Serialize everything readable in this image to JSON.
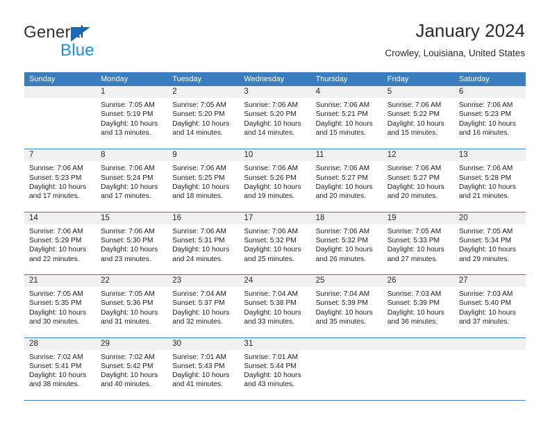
{
  "brand": {
    "name_part1": "General",
    "name_part2": "Blue",
    "triangle_color": "#1a6bb5",
    "blue_color": "#1a8fe0"
  },
  "header": {
    "title": "January 2024",
    "subtitle": "Crowley, Louisiana, United States",
    "header_bg_color": "#3a7ebf",
    "day_band_color": "#f0f0f0"
  },
  "weekdays": [
    "Sunday",
    "Monday",
    "Tuesday",
    "Wednesday",
    "Thursday",
    "Friday",
    "Saturday"
  ],
  "weeks": [
    [
      {
        "date": "",
        "sunrise": "",
        "sunset": "",
        "daylight_line1": "",
        "daylight_line2": ""
      },
      {
        "date": "1",
        "sunrise": "Sunrise: 7:05 AM",
        "sunset": "Sunset: 5:19 PM",
        "daylight_line1": "Daylight: 10 hours",
        "daylight_line2": "and 13 minutes."
      },
      {
        "date": "2",
        "sunrise": "Sunrise: 7:05 AM",
        "sunset": "Sunset: 5:20 PM",
        "daylight_line1": "Daylight: 10 hours",
        "daylight_line2": "and 14 minutes."
      },
      {
        "date": "3",
        "sunrise": "Sunrise: 7:06 AM",
        "sunset": "Sunset: 5:20 PM",
        "daylight_line1": "Daylight: 10 hours",
        "daylight_line2": "and 14 minutes."
      },
      {
        "date": "4",
        "sunrise": "Sunrise: 7:06 AM",
        "sunset": "Sunset: 5:21 PM",
        "daylight_line1": "Daylight: 10 hours",
        "daylight_line2": "and 15 minutes."
      },
      {
        "date": "5",
        "sunrise": "Sunrise: 7:06 AM",
        "sunset": "Sunset: 5:22 PM",
        "daylight_line1": "Daylight: 10 hours",
        "daylight_line2": "and 15 minutes."
      },
      {
        "date": "6",
        "sunrise": "Sunrise: 7:06 AM",
        "sunset": "Sunset: 5:23 PM",
        "daylight_line1": "Daylight: 10 hours",
        "daylight_line2": "and 16 minutes."
      }
    ],
    [
      {
        "date": "7",
        "sunrise": "Sunrise: 7:06 AM",
        "sunset": "Sunset: 5:23 PM",
        "daylight_line1": "Daylight: 10 hours",
        "daylight_line2": "and 17 minutes."
      },
      {
        "date": "8",
        "sunrise": "Sunrise: 7:06 AM",
        "sunset": "Sunset: 5:24 PM",
        "daylight_line1": "Daylight: 10 hours",
        "daylight_line2": "and 17 minutes."
      },
      {
        "date": "9",
        "sunrise": "Sunrise: 7:06 AM",
        "sunset": "Sunset: 5:25 PM",
        "daylight_line1": "Daylight: 10 hours",
        "daylight_line2": "and 18 minutes."
      },
      {
        "date": "10",
        "sunrise": "Sunrise: 7:06 AM",
        "sunset": "Sunset: 5:26 PM",
        "daylight_line1": "Daylight: 10 hours",
        "daylight_line2": "and 19 minutes."
      },
      {
        "date": "11",
        "sunrise": "Sunrise: 7:06 AM",
        "sunset": "Sunset: 5:27 PM",
        "daylight_line1": "Daylight: 10 hours",
        "daylight_line2": "and 20 minutes."
      },
      {
        "date": "12",
        "sunrise": "Sunrise: 7:06 AM",
        "sunset": "Sunset: 5:27 PM",
        "daylight_line1": "Daylight: 10 hours",
        "daylight_line2": "and 20 minutes."
      },
      {
        "date": "13",
        "sunrise": "Sunrise: 7:06 AM",
        "sunset": "Sunset: 5:28 PM",
        "daylight_line1": "Daylight: 10 hours",
        "daylight_line2": "and 21 minutes."
      }
    ],
    [
      {
        "date": "14",
        "sunrise": "Sunrise: 7:06 AM",
        "sunset": "Sunset: 5:29 PM",
        "daylight_line1": "Daylight: 10 hours",
        "daylight_line2": "and 22 minutes."
      },
      {
        "date": "15",
        "sunrise": "Sunrise: 7:06 AM",
        "sunset": "Sunset: 5:30 PM",
        "daylight_line1": "Daylight: 10 hours",
        "daylight_line2": "and 23 minutes."
      },
      {
        "date": "16",
        "sunrise": "Sunrise: 7:06 AM",
        "sunset": "Sunset: 5:31 PM",
        "daylight_line1": "Daylight: 10 hours",
        "daylight_line2": "and 24 minutes."
      },
      {
        "date": "17",
        "sunrise": "Sunrise: 7:06 AM",
        "sunset": "Sunset: 5:32 PM",
        "daylight_line1": "Daylight: 10 hours",
        "daylight_line2": "and 25 minutes."
      },
      {
        "date": "18",
        "sunrise": "Sunrise: 7:06 AM",
        "sunset": "Sunset: 5:32 PM",
        "daylight_line1": "Daylight: 10 hours",
        "daylight_line2": "and 26 minutes."
      },
      {
        "date": "19",
        "sunrise": "Sunrise: 7:05 AM",
        "sunset": "Sunset: 5:33 PM",
        "daylight_line1": "Daylight: 10 hours",
        "daylight_line2": "and 27 minutes."
      },
      {
        "date": "20",
        "sunrise": "Sunrise: 7:05 AM",
        "sunset": "Sunset: 5:34 PM",
        "daylight_line1": "Daylight: 10 hours",
        "daylight_line2": "and 29 minutes."
      }
    ],
    [
      {
        "date": "21",
        "sunrise": "Sunrise: 7:05 AM",
        "sunset": "Sunset: 5:35 PM",
        "daylight_line1": "Daylight: 10 hours",
        "daylight_line2": "and 30 minutes."
      },
      {
        "date": "22",
        "sunrise": "Sunrise: 7:05 AM",
        "sunset": "Sunset: 5:36 PM",
        "daylight_line1": "Daylight: 10 hours",
        "daylight_line2": "and 31 minutes."
      },
      {
        "date": "23",
        "sunrise": "Sunrise: 7:04 AM",
        "sunset": "Sunset: 5:37 PM",
        "daylight_line1": "Daylight: 10 hours",
        "daylight_line2": "and 32 minutes."
      },
      {
        "date": "24",
        "sunrise": "Sunrise: 7:04 AM",
        "sunset": "Sunset: 5:38 PM",
        "daylight_line1": "Daylight: 10 hours",
        "daylight_line2": "and 33 minutes."
      },
      {
        "date": "25",
        "sunrise": "Sunrise: 7:04 AM",
        "sunset": "Sunset: 5:39 PM",
        "daylight_line1": "Daylight: 10 hours",
        "daylight_line2": "and 35 minutes."
      },
      {
        "date": "26",
        "sunrise": "Sunrise: 7:03 AM",
        "sunset": "Sunset: 5:39 PM",
        "daylight_line1": "Daylight: 10 hours",
        "daylight_line2": "and 36 minutes."
      },
      {
        "date": "27",
        "sunrise": "Sunrise: 7:03 AM",
        "sunset": "Sunset: 5:40 PM",
        "daylight_line1": "Daylight: 10 hours",
        "daylight_line2": "and 37 minutes."
      }
    ],
    [
      {
        "date": "28",
        "sunrise": "Sunrise: 7:02 AM",
        "sunset": "Sunset: 5:41 PM",
        "daylight_line1": "Daylight: 10 hours",
        "daylight_line2": "and 38 minutes."
      },
      {
        "date": "29",
        "sunrise": "Sunrise: 7:02 AM",
        "sunset": "Sunset: 5:42 PM",
        "daylight_line1": "Daylight: 10 hours",
        "daylight_line2": "and 40 minutes."
      },
      {
        "date": "30",
        "sunrise": "Sunrise: 7:01 AM",
        "sunset": "Sunset: 5:43 PM",
        "daylight_line1": "Daylight: 10 hours",
        "daylight_line2": "and 41 minutes."
      },
      {
        "date": "31",
        "sunrise": "Sunrise: 7:01 AM",
        "sunset": "Sunset: 5:44 PM",
        "daylight_line1": "Daylight: 10 hours",
        "daylight_line2": "and 43 minutes."
      },
      {
        "date": "",
        "sunrise": "",
        "sunset": "",
        "daylight_line1": "",
        "daylight_line2": ""
      },
      {
        "date": "",
        "sunrise": "",
        "sunset": "",
        "daylight_line1": "",
        "daylight_line2": ""
      },
      {
        "date": "",
        "sunrise": "",
        "sunset": "",
        "daylight_line1": "",
        "daylight_line2": ""
      }
    ]
  ]
}
